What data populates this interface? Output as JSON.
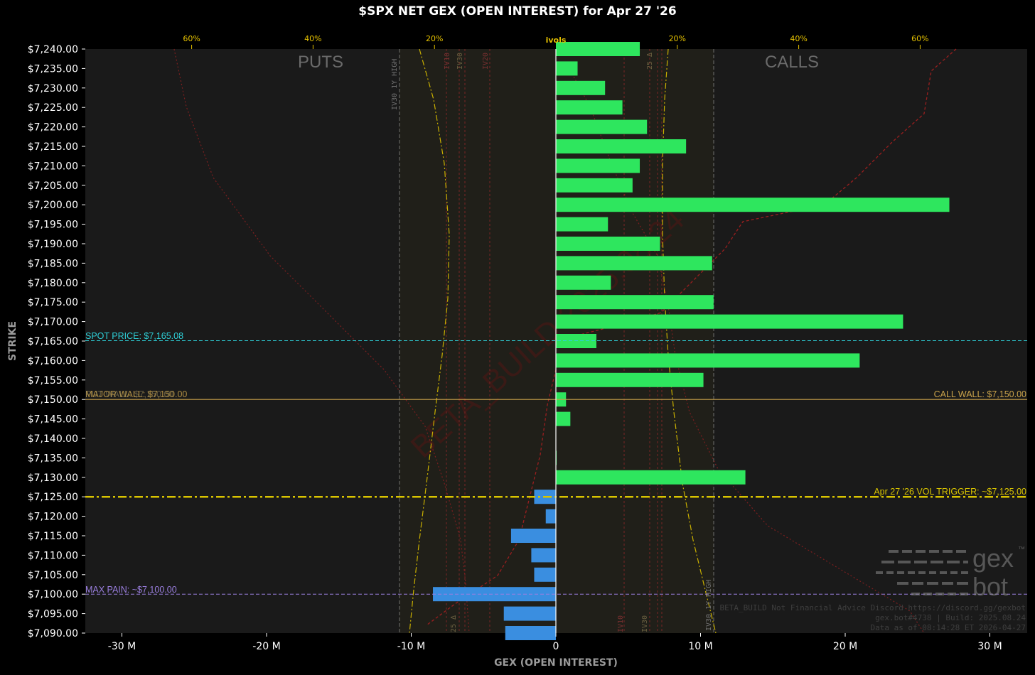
{
  "title": "$SPX NET GEX (OPEN INTEREST) for Apr 27 '26",
  "colors": {
    "calls": "#2ee65e",
    "puts": "#3a8ee0",
    "spot": "#2ed0d8",
    "walls": "#c9a24a",
    "vol_trigger": "#d9c400",
    "max_pain": "#9b7fe0",
    "background": "#1a1a1a",
    "ivol_axis": "#e6c200"
  },
  "labels": {
    "puts": "PUTS",
    "calls": "CALLS",
    "spot": "SPOT PRICE: $7,165.08",
    "put_wall": "PUT WALL: $7,150.00",
    "major_wall": "MAJOR WALL: $7,150.00",
    "call_wall": "CALL WALL: $7,150.00",
    "vol_trigger": "Apr 27 '26 VOL TRIGGER: ~$7,125.00",
    "max_pain": "MAX PAIN: ~$7,100.00",
    "iv30_1y_high_top": "IV30 1Y HIGH",
    "iv30_1y_high_bottom": "IV30 1Y HIGH",
    "iv30_top": "IV30",
    "iv10_top": "IV10",
    "iv20_top": "IV20",
    "iv10_bottom": "IV10",
    "iv30_bottom": "IV30",
    "delta25_top": "25 Δ",
    "delta25_bottom": "25 Δ"
  },
  "watermark": "BETA_BUILD 2025.08.24",
  "footer": {
    "line1": "BETA_BUILD Not Financial Advice Discord https://discord.gg/gexbot",
    "line2": "gex.bot#4738 | Build: 2025.08.24",
    "line3": "Data as of 08:14:28 ET 2026-04-27"
  },
  "logo": {
    "word1": "gex",
    "word2": "bot",
    "trademark": "™"
  },
  "chart_data": {
    "type": "bar",
    "orientation": "horizontal",
    "xlabel": "GEX (OPEN INTEREST)",
    "ylabel": "STRIKE",
    "xlim": [
      -33,
      33
    ],
    "ylim": [
      7090,
      7240
    ],
    "x_ticks": [
      "-30 M",
      "-20 M",
      "-10 M",
      "0",
      "10 M",
      "20 M",
      "30 M"
    ],
    "x_tick_values": [
      -30,
      -20,
      -10,
      0,
      10,
      20,
      30
    ],
    "top_axis_label": "ivols",
    "top_ticks": [
      "60%",
      "40%",
      "20%",
      "20%",
      "40%",
      "60%"
    ],
    "top_tick_values": [
      -60,
      -40,
      -20,
      20,
      40,
      60
    ],
    "categories": [
      "$7,240.00",
      "$7,235.00",
      "$7,230.00",
      "$7,225.00",
      "$7,220.00",
      "$7,215.00",
      "$7,210.00",
      "$7,205.00",
      "$7,200.00",
      "$7,195.00",
      "$7,190.00",
      "$7,185.00",
      "$7,180.00",
      "$7,175.00",
      "$7,170.00",
      "$7,165.00",
      "$7,160.00",
      "$7,155.00",
      "$7,150.00",
      "$7,145.00",
      "$7,140.00",
      "$7,135.00",
      "$7,130.00",
      "$7,125.00",
      "$7,120.00",
      "$7,115.00",
      "$7,110.00",
      "$7,105.00",
      "$7,100.00",
      "$7,095.00",
      "$7,090.00"
    ],
    "strikes": [
      7240,
      7235,
      7230,
      7225,
      7220,
      7215,
      7210,
      7205,
      7200,
      7195,
      7190,
      7185,
      7180,
      7175,
      7170,
      7165,
      7160,
      7155,
      7150,
      7145,
      7140,
      7135,
      7130,
      7125,
      7120,
      7115,
      7110,
      7105,
      7100,
      7095,
      7090
    ],
    "values": [
      5.8,
      1.5,
      3.4,
      4.6,
      6.3,
      9.0,
      5.8,
      5.3,
      27.2,
      3.6,
      7.2,
      10.8,
      3.8,
      10.9,
      24.0,
      2.8,
      21.0,
      10.2,
      0.7,
      1.0,
      0,
      0.05,
      13.1,
      -1.5,
      -0.7,
      -3.1,
      -1.7,
      -1.5,
      -8.5,
      -3.6,
      -3.5
    ],
    "spot_price": 7165.08,
    "call_wall": 7150,
    "put_wall": 7150,
    "major_wall": 7150,
    "vol_trigger": 7125,
    "max_pain": 7100,
    "grid": false,
    "legend": "none"
  }
}
